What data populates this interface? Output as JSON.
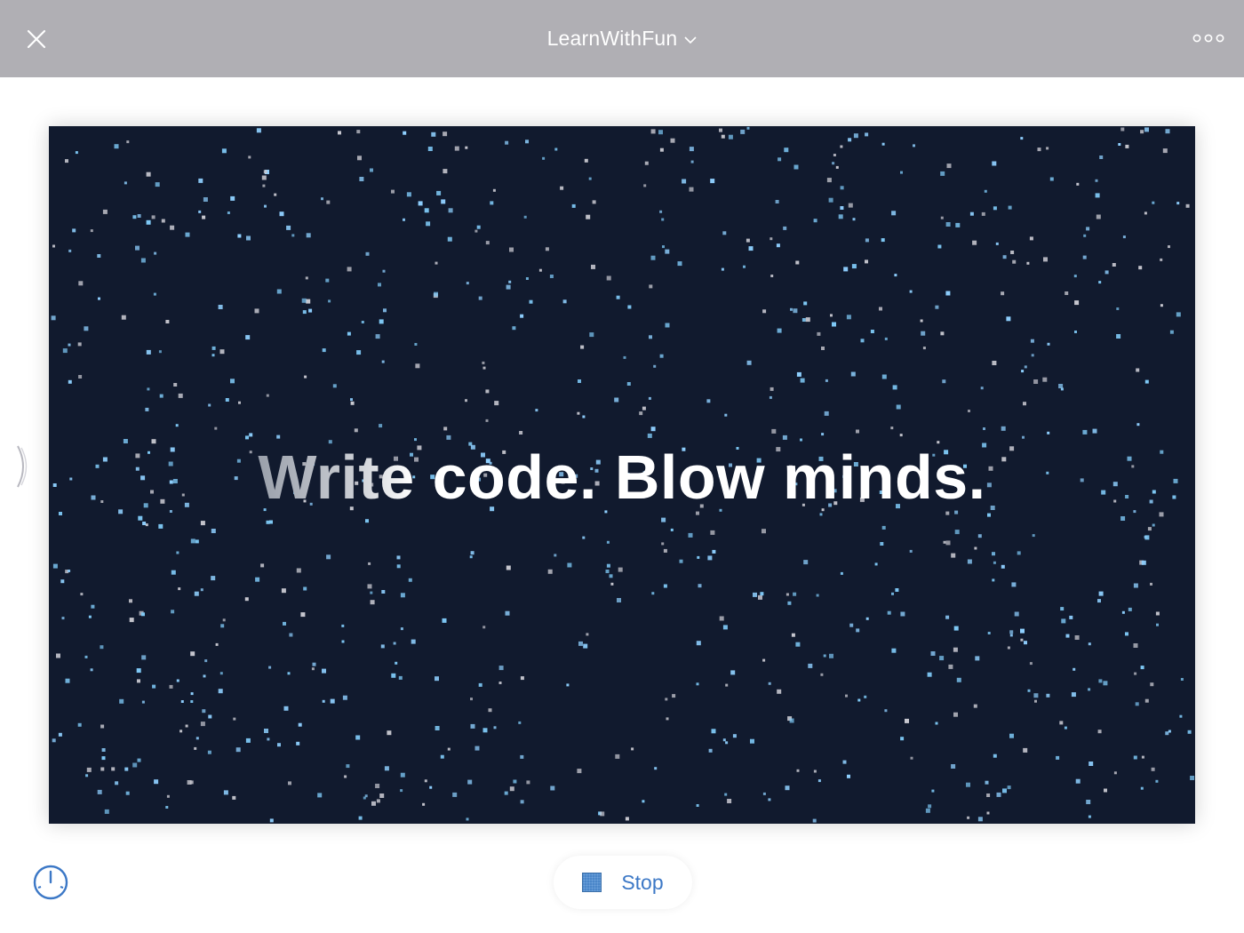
{
  "header": {
    "title": "LearnWithFun",
    "close_icon": "close-icon",
    "dropdown_icon": "chevron-down-icon",
    "more_icon": "more-icon"
  },
  "stage": {
    "headline_faded": "Write",
    "headline_rest": " code. Blow minds.",
    "background_color": "#111a2e",
    "particle_colors": [
      "#8fd0ff",
      "#c8c8d0",
      "#7ec8f5"
    ]
  },
  "controls": {
    "stop_label": "Stop",
    "stop_icon": "stop-square-icon",
    "speed_icon": "speedometer-icon",
    "side_handle_icon": "chevron-right-icon"
  },
  "colors": {
    "topbar": "#b0afb4",
    "accent": "#3c78c6"
  }
}
